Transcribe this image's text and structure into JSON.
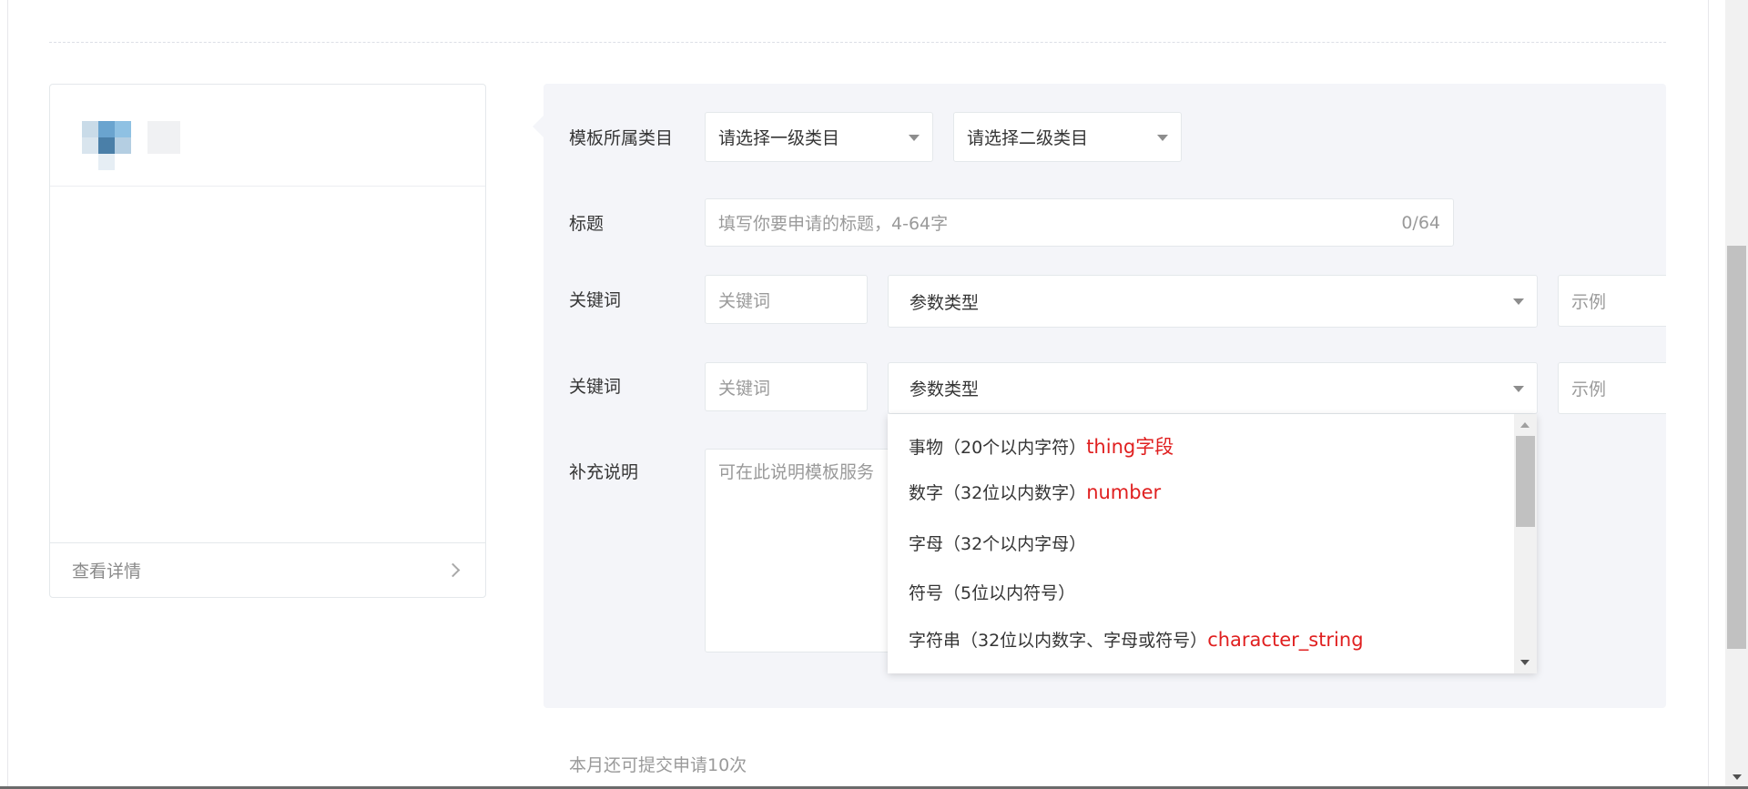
{
  "preview": {
    "view_detail": "查看详情"
  },
  "form": {
    "category_label": "模板所属类目",
    "category_primary": "请选择一级类目",
    "category_secondary": "请选择二级类目",
    "title_label": "标题",
    "title_placeholder": "填写你要申请的标题，4-64字",
    "title_counter": "0/64",
    "keyword_rows": [
      {
        "label": "关键词",
        "keyword_placeholder": "关键词",
        "param_type": "参数类型",
        "example_placeholder": "示例"
      },
      {
        "label": "关键词",
        "keyword_placeholder": "关键词",
        "param_type": "参数类型",
        "example_placeholder": "示例"
      }
    ],
    "note_label": "补充说明",
    "note_placeholder": "可在此说明模板服务"
  },
  "dropdown": {
    "options": [
      {
        "text": "事物（20个以内字符）",
        "highlight": "thing字段"
      },
      {
        "text": "数字（32位以内数字）",
        "highlight": "number"
      },
      {
        "text": "字母（32个以内字母）",
        "highlight": ""
      },
      {
        "text": "符号（5位以内符号）",
        "highlight": ""
      },
      {
        "text": "字符串（32位以内数字、字母或符号）",
        "highlight": "character_string"
      }
    ]
  },
  "footer": {
    "quota": "本月还可提交申请10次"
  },
  "colors": {
    "panel_bg": "#f4f5f9",
    "highlight_red": "#e02020",
    "border": "#e4e8eb"
  }
}
